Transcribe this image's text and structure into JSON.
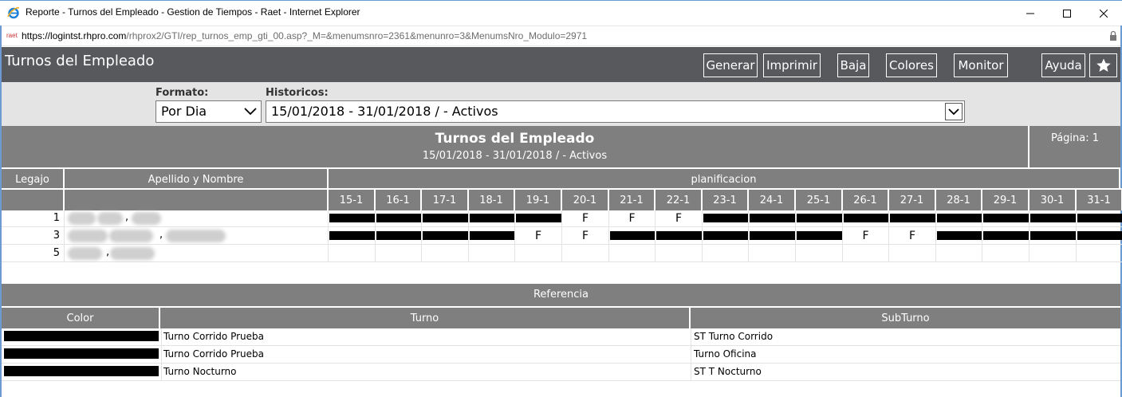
{
  "window": {
    "title": "Reporte - Turnos del Empleado - Gestion de Tiempos - Raet - Internet Explorer",
    "url_prefix": "https://",
    "url_host": "logintst.rhpro.com",
    "url_path": "/rhprox2/GTI/rep_turnos_emp_gti_00.asp?_M=&menumsnro=2361&menunro=3&MenumsNro_Modulo=2971"
  },
  "header": {
    "title": "Turnos del Empleado",
    "buttons": {
      "generar": "Generar",
      "imprimir": "Imprimir",
      "baja": "Baja",
      "colores": "Colores",
      "monitor": "Monitor",
      "ayuda": "Ayuda"
    }
  },
  "filters": {
    "formato_label": "Formato:",
    "formato_value": "Por Dia",
    "historicos_label": "Historicos:",
    "historicos_value": "15/01/2018 - 31/01/2018 / - Activos"
  },
  "report": {
    "title": "Turnos del Empleado",
    "subtitle": "15/01/2018 - 31/01/2018 / - Activos",
    "page": "Página: 1"
  },
  "grid": {
    "col_legajo": "Legajo",
    "col_nombre": "Apellido y Nombre",
    "col_planificacion": "planificacion",
    "days": [
      "15-1",
      "16-1",
      "17-1",
      "18-1",
      "19-1",
      "20-1",
      "21-1",
      "22-1",
      "23-1",
      "24-1",
      "25-1",
      "26-1",
      "27-1",
      "28-1",
      "29-1",
      "30-1",
      "31-1"
    ],
    "rows": [
      {
        "legajo": "1",
        "name_sep": ",",
        "cells": [
          "B",
          "B",
          "B",
          "B",
          "B",
          "F",
          "F",
          "F",
          "B",
          "B",
          "B",
          "B",
          "B",
          "B",
          "B",
          "B",
          "B"
        ]
      },
      {
        "legajo": "3",
        "name_sep": ",",
        "cells": [
          "B",
          "B",
          "B",
          "B",
          "F",
          "F",
          "B",
          "B",
          "B",
          "B",
          "B",
          "F",
          "F",
          "B",
          "B",
          "B",
          "B"
        ]
      },
      {
        "legajo": "5",
        "name_sep": ",",
        "cells": [
          "",
          "",
          "",
          "",
          "",
          "",
          "",
          "",
          "",
          "",
          "",
          "",
          "",
          "",
          "",
          "",
          ""
        ]
      }
    ]
  },
  "reference": {
    "title": "Referencia",
    "col_color": "Color",
    "col_turno": "Turno",
    "col_subturno": "SubTurno",
    "rows": [
      {
        "color": "#000000",
        "turno": "Turno Corrido Prueba",
        "subturno": "ST Turno Corrido"
      },
      {
        "color": "#000000",
        "turno": "Turno Corrido Prueba",
        "subturno": "Turno Oficina"
      },
      {
        "color": "#000000",
        "turno": "Turno Nocturno",
        "subturno": "ST T Nocturno"
      }
    ]
  },
  "colors": {
    "header_bg": "#57595d",
    "filter_bg": "#e4e4e4",
    "table_header_bg": "#7f7f7f",
    "shift_bar": "#000000"
  }
}
